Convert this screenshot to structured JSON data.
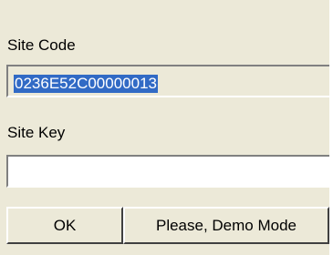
{
  "site_code": {
    "label": "Site Code",
    "value": "0236E52C00000013"
  },
  "site_key": {
    "label": "Site Key",
    "value": ""
  },
  "buttons": {
    "ok": "OK",
    "demo": "Please, Demo Mode"
  },
  "colors": {
    "dialog_bg": "#ece9d8",
    "selection": "#316ac5"
  }
}
